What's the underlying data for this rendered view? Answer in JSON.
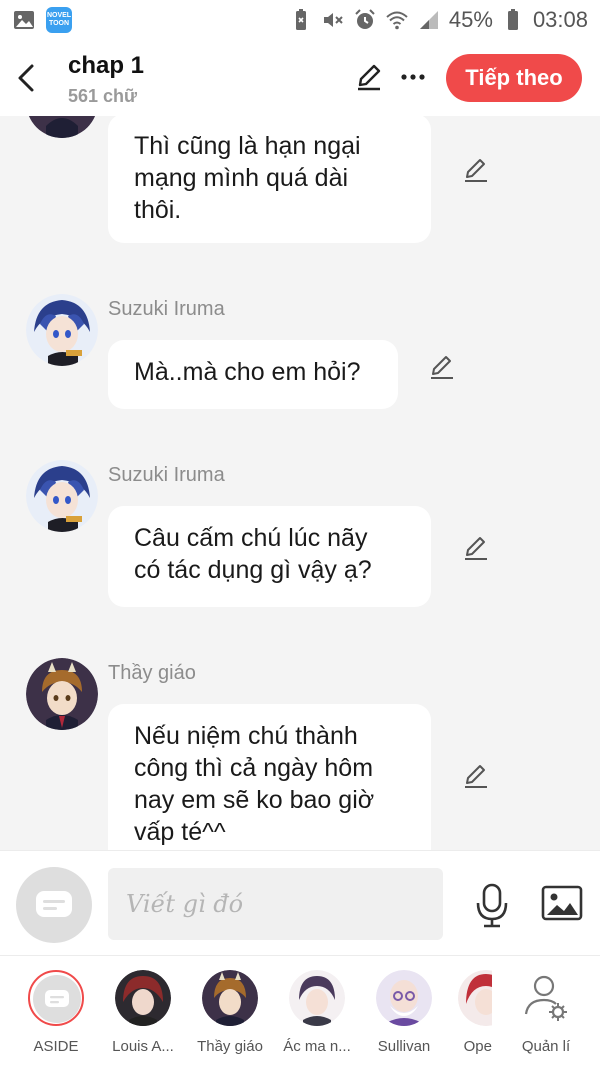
{
  "status_bar": {
    "battery": "45%",
    "time": "03:08",
    "novel_toon_logo": "NOVEL TOON"
  },
  "header": {
    "title": "chap 1",
    "word_count": "561 chữ",
    "next_label": "Tiếp theo",
    "accent": "#f04a4a"
  },
  "messages": [
    {
      "speaker": "",
      "text": [
        "Thì cũng là hạn ngại",
        "mạng mình quá dài",
        "thôi."
      ]
    },
    {
      "speaker": "Suzuki Iruma",
      "text": [
        "Mà..mà cho em hỏi?"
      ]
    },
    {
      "speaker": "Suzuki Iruma",
      "text": [
        "Câu cấm chú lúc nãy",
        "có tác dụng gì vậy ạ?"
      ]
    },
    {
      "speaker": "Thầy giáo",
      "text": [
        "Nếu niệm chú thành",
        "công thì cả ngày hôm",
        "nay em sẽ ko bao giờ",
        "vấp té^^"
      ]
    }
  ],
  "input": {
    "placeholder": "Viết gì đó"
  },
  "characters": [
    {
      "label": "ASIDE"
    },
    {
      "label": "Louis A..."
    },
    {
      "label": "Thầy giáo"
    },
    {
      "label": "Ác ma n..."
    },
    {
      "label": "Sullivan"
    },
    {
      "label": "Ope"
    },
    {
      "label": "Quản lí"
    }
  ]
}
